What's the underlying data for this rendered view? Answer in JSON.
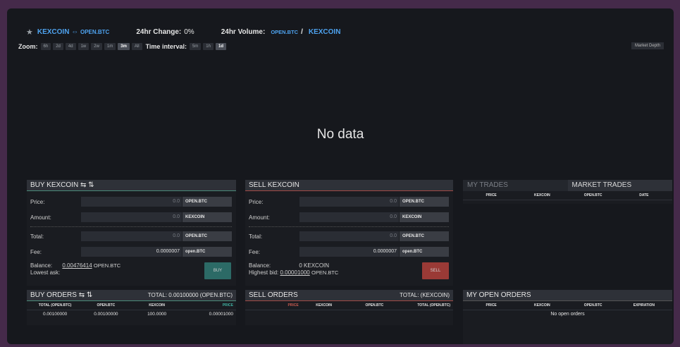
{
  "header": {
    "pair_base": "KEXCOIN",
    "pair_arrow": "⇔",
    "pair_quote": "OPEN.BTC",
    "change_label": "24hr Change:",
    "change_value": "0%",
    "volume_label": "24hr Volume:",
    "volume_quote": "OPEN.BTC",
    "volume_sep": "/",
    "volume_base": "KEXCOIN"
  },
  "zoom": {
    "label": "Zoom:",
    "options": [
      "6h",
      "2d",
      "4d",
      "1w",
      "2w",
      "1m",
      "3m",
      "All"
    ],
    "active": "3m",
    "interval_label": "Time interval:",
    "intervals": [
      "5m",
      "1h",
      "1d"
    ],
    "interval_active": "1d",
    "market_depth": "Market Depth"
  },
  "chart": {
    "no_data": "No data"
  },
  "buy_form": {
    "title": "BUY KEXCOIN ⇆ ⇅",
    "price_label": "Price:",
    "price_value": "0.0",
    "price_unit": "OPEN.BTC",
    "amount_label": "Amount:",
    "amount_value": "0.0",
    "amount_unit": "KEXCOIN",
    "total_label": "Total:",
    "total_value": "0.0",
    "total_unit": "OPEN.BTC",
    "fee_label": "Fee:",
    "fee_value": "0.0000007",
    "fee_unit": "open.BTC",
    "balance_label": "Balance:",
    "balance_value": "0.00476414",
    "balance_unit": "OPEN.BTC",
    "lowest_ask_label": "Lowest ask:",
    "button": "BUY"
  },
  "sell_form": {
    "title": "SELL KEXCOIN",
    "price_label": "Price:",
    "price_value": "0.0",
    "price_unit": "OPEN.BTC",
    "amount_label": "Amount:",
    "amount_value": "0.0",
    "amount_unit": "KEXCOIN",
    "total_label": "Total:",
    "total_value": "0.0",
    "total_unit": "OPEN.BTC",
    "fee_label": "Fee:",
    "fee_value": "0.0000007",
    "fee_unit": "open.BTC",
    "balance_label": "Balance:",
    "balance_value": "0 KEXCOIN",
    "highest_bid_label": "Highest bid:",
    "highest_bid_value": "0.00001000",
    "highest_bid_unit": "OPEN.BTC",
    "button": "SELL"
  },
  "trades": {
    "tab_my": "MY TRADES",
    "tab_market": "MARKET TRADES",
    "columns": [
      "PRICE",
      "KEXCOIN",
      "OPEN.BTC",
      "DATE"
    ]
  },
  "buy_orders": {
    "title": "BUY ORDERS ⇆ ⇅",
    "total": "TOTAL: 0.00100000 (OPEN.BTC)",
    "columns": [
      "TOTAL (OPEN.BTC)",
      "OPEN.BTC",
      "KEXCOIN",
      "PRICE"
    ],
    "rows": [
      [
        "0.00100000",
        "0.00100000",
        "100.0000",
        "0.00001000"
      ]
    ]
  },
  "sell_orders": {
    "title": "SELL ORDERS",
    "total": "TOTAL: (KEXCOIN)",
    "columns": [
      "PRICE",
      "KEXCOIN",
      "OPEN.BTC",
      "TOTAL (OPEN.BTC)"
    ]
  },
  "open_orders": {
    "title": "MY OPEN ORDERS",
    "columns": [
      "PRICE",
      "KEXCOIN",
      "OPEN.BTC",
      "EXPIRATION"
    ],
    "empty": "No open orders"
  },
  "colors": {
    "accent_blue": "#4ea3f0",
    "buy_green": "#2c6a66",
    "sell_red": "#9a3a36",
    "background": "#16181d"
  }
}
